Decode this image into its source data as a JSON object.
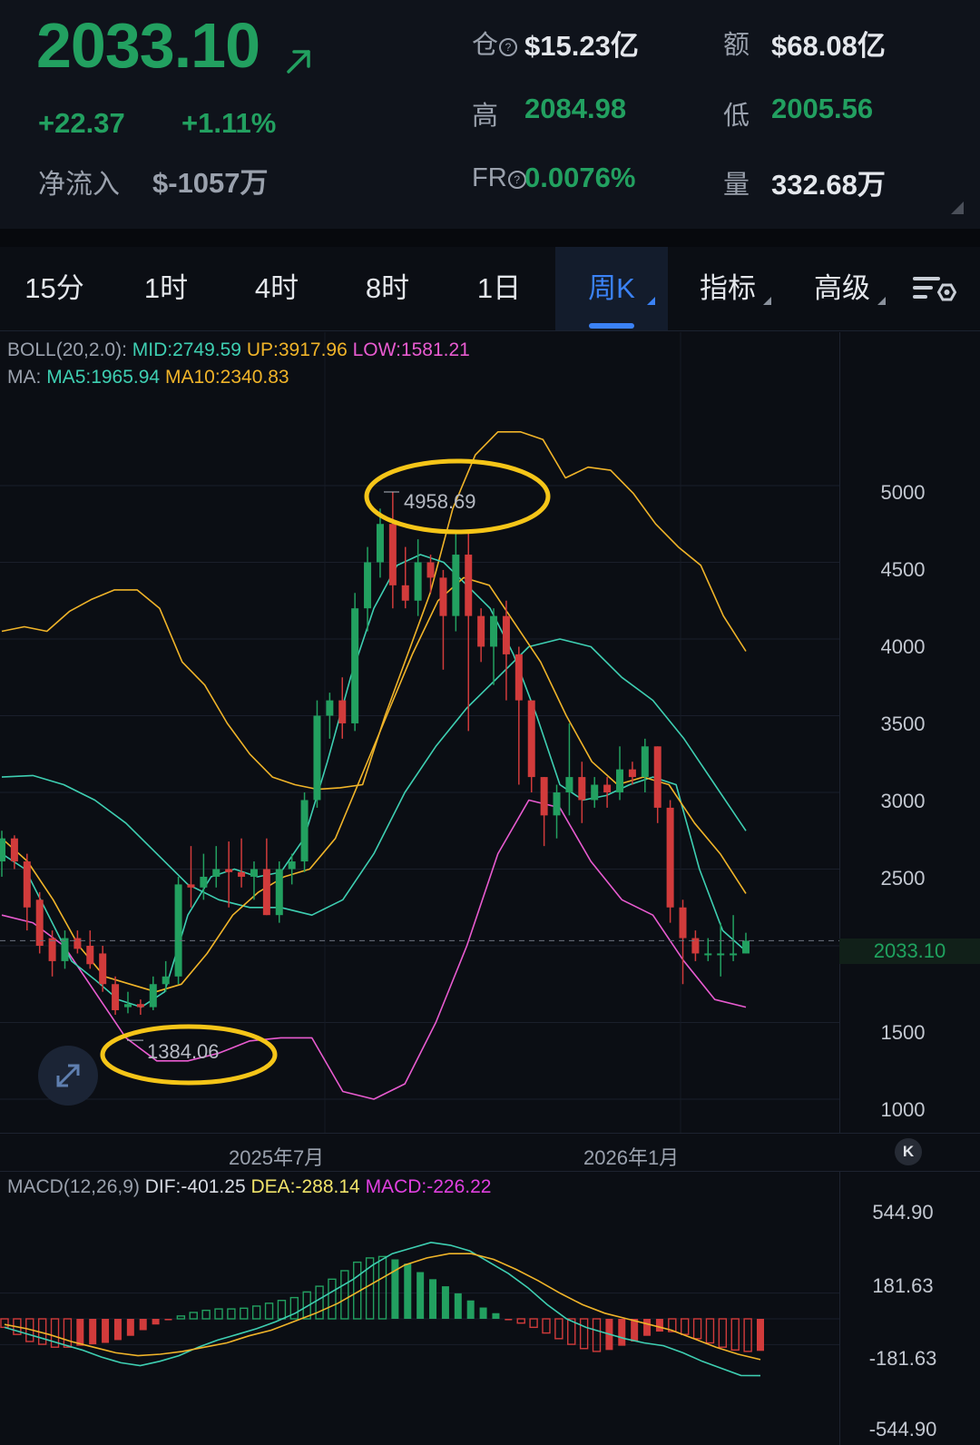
{
  "quote": {
    "price": "2033.10",
    "change": "+22.37",
    "change_pct": "+1.11%",
    "net_inflow_label": "净流入",
    "net_inflow_value": "$-1057万",
    "stats": {
      "open_interest_label": "仓",
      "open_interest_value": "$15.23亿",
      "turnover_label": "额",
      "turnover_value": "$68.08亿",
      "high_label": "高",
      "high_value": "2084.98",
      "low_label": "低",
      "low_value": "2005.56",
      "fr_label": "FR",
      "fr_value": "0.0076%",
      "volume_label": "量",
      "volume_value": "332.68万"
    },
    "up_color": "#22a060",
    "down_color": "#d13b3b"
  },
  "tabs": [
    {
      "label": "15分"
    },
    {
      "label": "1时"
    },
    {
      "label": "4时"
    },
    {
      "label": "8时"
    },
    {
      "label": "1日"
    },
    {
      "label": "周K",
      "active": true
    },
    {
      "label": "指标"
    },
    {
      "label": "高级"
    }
  ],
  "icons": {
    "trend": "trend-up-arrow-icon",
    "settings": "chart-settings-icon",
    "expand": "expand-icon",
    "collapse": "collapse-icon"
  },
  "main_chart": {
    "boll_prefix": "BOLL(20,2.0):",
    "boll_mid": "MID:2749.59",
    "boll_up": "UP:3917.96",
    "boll_low": "LOW:1581.21",
    "ma_prefix": "MA:",
    "ma5": "MA5:1965.94",
    "ma10": "MA10:2340.83",
    "y_ticks": [
      "5000",
      "4500",
      "4000",
      "3500",
      "3000",
      "2500",
      "1500",
      "1000"
    ],
    "x_ticks": [
      "2025年7月",
      "2026年1月"
    ],
    "current_price": "2033.10",
    "high_annotation": "4958.69",
    "low_annotation": "1384.06",
    "colors": {
      "mid": "#3ecfb2",
      "up": "#f0b429",
      "low": "#e85bd0",
      "ma5": "#3ecfb2",
      "ma10": "#f0b429",
      "highlight": "#f5c518"
    }
  },
  "macd": {
    "prefix": "MACD(12,26,9)",
    "dif": "DIF:-401.25",
    "dea": "DEA:-288.14",
    "macd": "MACD:-226.22",
    "y_ticks": [
      "544.90",
      "181.63",
      "-181.63",
      "-544.90"
    ],
    "colors": {
      "dif": "#3ecfb2",
      "dea": "#f0b429",
      "macd": "#e040e0"
    }
  },
  "chart_data": {
    "type": "candlestick",
    "timeframe": "周K",
    "ylim": [
      900,
      5400
    ],
    "candles": [
      {
        "o": 2550,
        "h": 2750,
        "l": 2450,
        "c": 2700
      },
      {
        "o": 2700,
        "h": 2720,
        "l": 2500,
        "c": 2550
      },
      {
        "o": 2550,
        "h": 2600,
        "l": 2100,
        "c": 2250
      },
      {
        "o": 2300,
        "h": 2350,
        "l": 1950,
        "c": 2000
      },
      {
        "o": 2050,
        "h": 2100,
        "l": 1800,
        "c": 1900
      },
      {
        "o": 1900,
        "h": 2100,
        "l": 1850,
        "c": 2050
      },
      {
        "o": 2050,
        "h": 2100,
        "l": 1950,
        "c": 1980
      },
      {
        "o": 2000,
        "h": 2100,
        "l": 1850,
        "c": 1880
      },
      {
        "o": 1950,
        "h": 2000,
        "l": 1700,
        "c": 1750
      },
      {
        "o": 1750,
        "h": 1800,
        "l": 1550,
        "c": 1580
      },
      {
        "o": 1600,
        "h": 1700,
        "l": 1560,
        "c": 1620
      },
      {
        "o": 1620,
        "h": 1650,
        "l": 1550,
        "c": 1600
      },
      {
        "o": 1600,
        "h": 1800,
        "l": 1580,
        "c": 1750
      },
      {
        "o": 1750,
        "h": 1900,
        "l": 1700,
        "c": 1800
      },
      {
        "o": 1800,
        "h": 2450,
        "l": 1750,
        "c": 2400
      },
      {
        "o": 2400,
        "h": 2650,
        "l": 2250,
        "c": 2380
      },
      {
        "o": 2380,
        "h": 2600,
        "l": 2300,
        "c": 2450
      },
      {
        "o": 2450,
        "h": 2650,
        "l": 2380,
        "c": 2500
      },
      {
        "o": 2500,
        "h": 2680,
        "l": 2250,
        "c": 2480
      },
      {
        "o": 2480,
        "h": 2700,
        "l": 2380,
        "c": 2450
      },
      {
        "o": 2450,
        "h": 2550,
        "l": 2300,
        "c": 2500
      },
      {
        "o": 2500,
        "h": 2700,
        "l": 2200,
        "c": 2200
      },
      {
        "o": 2200,
        "h": 2550,
        "l": 2150,
        "c": 2500
      },
      {
        "o": 2500,
        "h": 2600,
        "l": 2400,
        "c": 2550
      },
      {
        "o": 2550,
        "h": 3000,
        "l": 2480,
        "c": 2950
      },
      {
        "o": 2950,
        "h": 3600,
        "l": 2900,
        "c": 3500
      },
      {
        "o": 3500,
        "h": 3650,
        "l": 3350,
        "c": 3600
      },
      {
        "o": 3600,
        "h": 3750,
        "l": 3350,
        "c": 3450
      },
      {
        "o": 3450,
        "h": 4300,
        "l": 3400,
        "c": 4200
      },
      {
        "o": 4200,
        "h": 4600,
        "l": 4050,
        "c": 4500
      },
      {
        "o": 4500,
        "h": 4850,
        "l": 4400,
        "c": 4750
      },
      {
        "o": 4750,
        "h": 4958.69,
        "l": 4200,
        "c": 4350
      },
      {
        "o": 4350,
        "h": 4600,
        "l": 4200,
        "c": 4250
      },
      {
        "o": 4250,
        "h": 4650,
        "l": 4150,
        "c": 4500
      },
      {
        "o": 4500,
        "h": 4550,
        "l": 4300,
        "c": 4400
      },
      {
        "o": 4400,
        "h": 4450,
        "l": 3800,
        "c": 4150
      },
      {
        "o": 4150,
        "h": 4700,
        "l": 4050,
        "c": 4550
      },
      {
        "o": 4550,
        "h": 4700,
        "l": 3400,
        "c": 4150
      },
      {
        "o": 4150,
        "h": 4200,
        "l": 3850,
        "c": 3950
      },
      {
        "o": 3950,
        "h": 4200,
        "l": 3700,
        "c": 4150
      },
      {
        "o": 4150,
        "h": 4250,
        "l": 3600,
        "c": 3900
      },
      {
        "o": 3900,
        "h": 3950,
        "l": 3050,
        "c": 3600
      },
      {
        "o": 3600,
        "h": 3600,
        "l": 3000,
        "c": 3100
      },
      {
        "o": 3100,
        "h": 3100,
        "l": 2650,
        "c": 2850
      },
      {
        "o": 2850,
        "h": 3050,
        "l": 2700,
        "c": 3000
      },
      {
        "o": 3000,
        "h": 3450,
        "l": 2850,
        "c": 3100
      },
      {
        "o": 3100,
        "h": 3200,
        "l": 2800,
        "c": 2950
      },
      {
        "o": 2950,
        "h": 3100,
        "l": 2900,
        "c": 3050
      },
      {
        "o": 3050,
        "h": 3100,
        "l": 2900,
        "c": 3000
      },
      {
        "o": 3000,
        "h": 3300,
        "l": 2950,
        "c": 3150
      },
      {
        "o": 3150,
        "h": 3200,
        "l": 3050,
        "c": 3100
      },
      {
        "o": 3100,
        "h": 3350,
        "l": 3000,
        "c": 3300
      },
      {
        "o": 3300,
        "h": 3300,
        "l": 2800,
        "c": 2900
      },
      {
        "o": 2900,
        "h": 2950,
        "l": 2150,
        "c": 2250
      },
      {
        "o": 2250,
        "h": 2300,
        "l": 1750,
        "c": 2050
      },
      {
        "o": 2050,
        "h": 2100,
        "l": 1900,
        "c": 1950
      },
      {
        "o": 1950,
        "h": 2050,
        "l": 1900,
        "c": 1950
      },
      {
        "o": 1950,
        "h": 2150,
        "l": 1800,
        "c": 1950
      },
      {
        "o": 1950,
        "h": 2200,
        "l": 1900,
        "c": 1950
      },
      {
        "o": 1950,
        "h": 2085,
        "l": 1950,
        "c": 2033.1
      }
    ],
    "series": [
      {
        "name": "UP",
        "values": [
          4050,
          4080,
          4050,
          4180,
          4260,
          4320,
          4320,
          4200,
          3850,
          3700,
          3450,
          3250,
          3100,
          3050,
          3020,
          3030,
          3050,
          3500,
          3900,
          4300,
          4850,
          5200,
          5350,
          5350,
          5300,
          5050,
          5120,
          5100,
          4950,
          4750,
          4600,
          4480,
          4150,
          3920
        ]
      },
      {
        "name": "MID",
        "values": [
          3100,
          3110,
          3050,
          2950,
          2800,
          2600,
          2400,
          2300,
          2250,
          2250,
          2200,
          2300,
          2600,
          3000,
          3300,
          3550,
          3750,
          3950,
          4000,
          3950,
          3750,
          3600,
          3350,
          3050,
          2750
        ]
      },
      {
        "name": "LOW",
        "values": [
          2200,
          2150,
          2000,
          1700,
          1400,
          1250,
          1250,
          1300,
          1380,
          1400,
          1400,
          1050,
          1000,
          1100,
          1500,
          2000,
          2600,
          2950,
          2900,
          2550,
          2300,
          2200,
          1900,
          1650,
          1600
        ]
      },
      {
        "name": "MA5",
        "values": [
          2600,
          2500,
          2200,
          1900,
          1780,
          1650,
          1600,
          1700,
          2200,
          2450,
          2500,
          2450,
          2480,
          2700,
          3200,
          3750,
          4200,
          4480,
          4550,
          4500,
          4350,
          4200,
          3900,
          3500,
          3050,
          2950,
          2980,
          3050,
          3100,
          3050,
          2500,
          2100,
          1965.94
        ]
      },
      {
        "name": "MA10",
        "values": [
          2700,
          2550,
          2300,
          2000,
          1800,
          1750,
          1700,
          1750,
          1950,
          2200,
          2350,
          2450,
          2500,
          2700,
          3100,
          3500,
          3900,
          4250,
          4400,
          4350,
          4100,
          3850,
          3500,
          3200,
          3050,
          3100,
          3050,
          2800,
          2600,
          2340.83
        ]
      }
    ],
    "macd": {
      "ylim": [
        -545,
        545
      ],
      "hist": [
        -60,
        -110,
        -160,
        -180,
        -200,
        -200,
        -190,
        -180,
        -170,
        -150,
        -120,
        -80,
        -40,
        -10,
        20,
        45,
        60,
        70,
        70,
        75,
        90,
        110,
        130,
        150,
        190,
        230,
        280,
        340,
        400,
        430,
        440,
        420,
        390,
        330,
        280,
        230,
        180,
        130,
        80,
        40,
        -10,
        -30,
        -60,
        -100,
        -140,
        -180,
        -210,
        -230,
        -220,
        -190,
        -160,
        -120,
        -90,
        -90,
        -110,
        -140,
        -170,
        -200,
        -220,
        -230,
        -226.22
      ],
      "dif": [
        -60,
        -100,
        -140,
        -180,
        -220,
        -270,
        -310,
        -330,
        -300,
        -260,
        -200,
        -150,
        -110,
        -70,
        -20,
        40,
        120,
        200,
        280,
        380,
        460,
        500,
        540,
        520,
        480,
        400,
        320,
        220,
        100,
        0,
        -60,
        -100,
        -140,
        -170,
        -190,
        -240,
        -300,
        -350,
        -400,
        -401.25
      ],
      "dea": [
        -40,
        -70,
        -110,
        -160,
        -200,
        -240,
        -260,
        -250,
        -230,
        -200,
        -170,
        -120,
        -80,
        -20,
        40,
        110,
        200,
        290,
        380,
        430,
        460,
        460,
        420,
        350,
        270,
        180,
        100,
        40,
        0,
        -40,
        -80,
        -140,
        -200,
        -250,
        -288.14
      ]
    }
  }
}
